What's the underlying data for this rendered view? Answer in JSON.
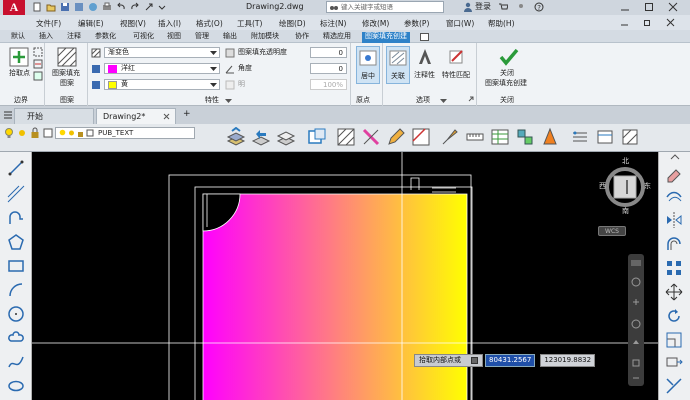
{
  "app": {
    "logo_letter": "A",
    "document_title": "Drawing2.dwg",
    "search_placeholder": "键入关键字或短语",
    "login_label": "登录"
  },
  "menu": {
    "items": [
      "文件(F)",
      "编辑(E)",
      "视图(V)",
      "插入(I)",
      "格式(O)",
      "工具(T)",
      "绘图(D)",
      "标注(N)",
      "修改(M)",
      "参数(P)",
      "窗口(W)",
      "帮助(H)"
    ]
  },
  "ribbon_tabs": {
    "items": [
      "默认",
      "插入",
      "注释",
      "参数化",
      "可视化",
      "视图",
      "管理",
      "输出",
      "附加模块",
      "协作",
      "精选应用",
      "图案填充创建"
    ],
    "active_index": 11
  },
  "ribbon": {
    "boundary": {
      "pick_label": "拾取点",
      "group_label": "边界"
    },
    "pattern": {
      "btn_label_1": "图案填充",
      "btn_label_2": "图案",
      "group_label": "图案"
    },
    "properties": {
      "type_value": "渐变色",
      "color1_value": "洋红",
      "color2_value": "黄",
      "transparency_label": "图案填充透明度",
      "transparency_value": "0",
      "angle_label": "角度",
      "angle_value": "0",
      "percent_label": "明",
      "percent_value": "100%",
      "group_label": "特性"
    },
    "origin": {
      "center_label": "居中",
      "group_label": "原点"
    },
    "options": {
      "assoc_label": "关联",
      "annotative_label": "注释性",
      "match_label": "特性匹配",
      "group_label": "选项"
    },
    "close": {
      "label_1": "关闭",
      "label_2": "图案填充创建",
      "group_label": "关闭"
    }
  },
  "doctabs": {
    "start_label": "开始",
    "doc_label": "Drawing2*",
    "add_label": "+"
  },
  "layer": {
    "name": "PUB_TEXT"
  },
  "viewcube": {
    "north": "北",
    "south": "南",
    "east": "东",
    "west": "西",
    "wcs": "WCS"
  },
  "cursor_tooltip": {
    "prompt": "拾取内部点或",
    "x_value": "80431.2567",
    "y_value": "123019.8832"
  },
  "colors": {
    "gradient_start": "#ff00ff",
    "gradient_end": "#ffff00",
    "ribbon_active": "#2f82c8",
    "canvas_bg": "#000000",
    "logo_red": "#c8102e"
  }
}
